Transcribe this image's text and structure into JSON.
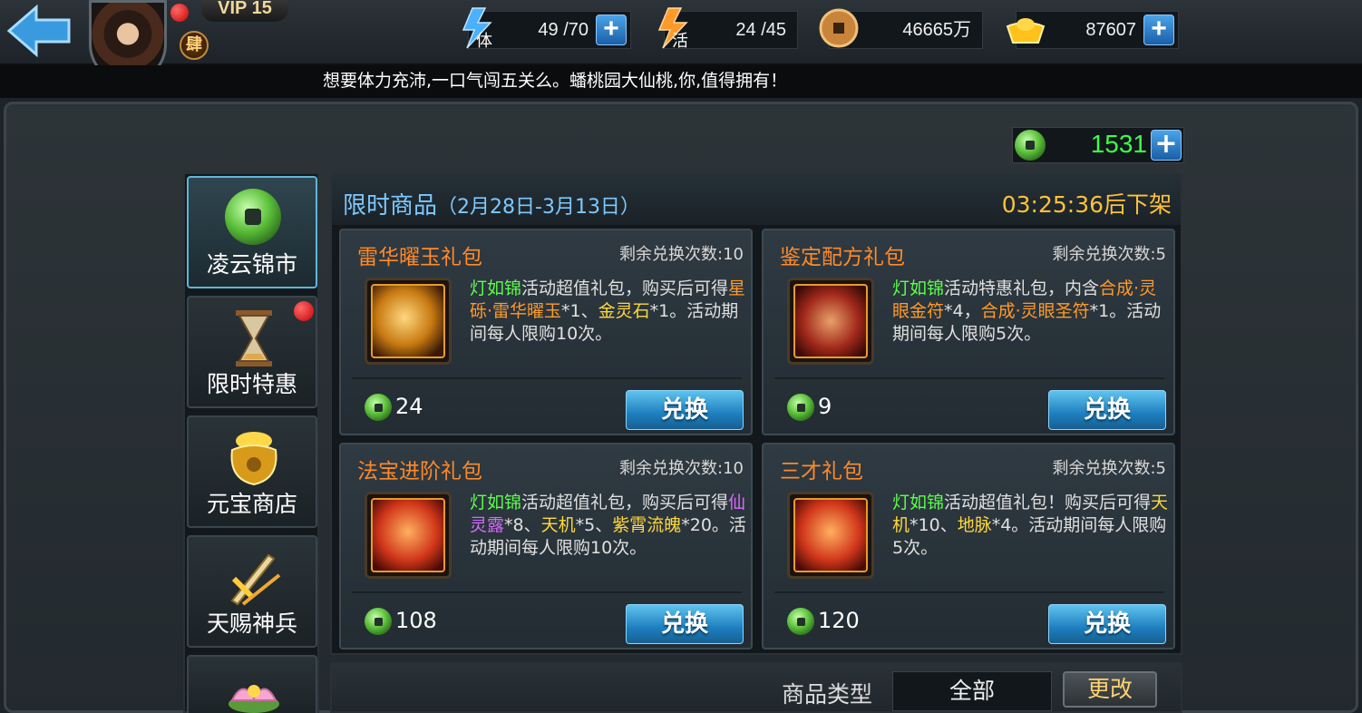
{
  "player": {
    "vip": "VIP 15",
    "rank": "肆"
  },
  "resources": {
    "stamina": {
      "icon_char": "体",
      "value": "49 /70"
    },
    "vitality": {
      "icon_char": "活",
      "value": "24 /45"
    },
    "copper": {
      "value": "46665万"
    },
    "gold": {
      "value": "87607"
    }
  },
  "marquee": "想要体力充沛,一口气闯五关么。蟠桃园大仙桃,你,值得拥有！",
  "jade_balance": "1531",
  "sidebar": {
    "items": [
      {
        "label": "凌云锦市",
        "active": true,
        "badge": false
      },
      {
        "label": "限时特惠",
        "active": false,
        "badge": true
      },
      {
        "label": "元宝商店",
        "active": false,
        "badge": false
      },
      {
        "label": "天赐神兵",
        "active": false,
        "badge": false
      }
    ]
  },
  "header": {
    "title": "限时商品",
    "date": "（2月28日-3月13日）",
    "countdown": "03:25:36后下架"
  },
  "cards": [
    {
      "name": "雷华曜玉礼包",
      "remain": "剩余兑换次数:10",
      "desc": [
        {
          "t": "灯如锦",
          "c": "g"
        },
        {
          "t": "活动超值礼包，购买后可得",
          "c": ""
        },
        {
          "t": "星砾·雷华曜玉",
          "c": "o"
        },
        {
          "t": "*1、",
          "c": ""
        },
        {
          "t": "金灵石",
          "c": "y"
        },
        {
          "t": "*1。活动期间每人限购10次。",
          "c": ""
        }
      ],
      "price": "24",
      "button": "兑换",
      "thumb_color": "#c87a12"
    },
    {
      "name": "鉴定配方礼包",
      "remain": "剩余兑换次数:5",
      "desc": [
        {
          "t": "灯如锦",
          "c": "g"
        },
        {
          "t": "活动特惠礼包，内含",
          "c": ""
        },
        {
          "t": "合成·灵眼金符",
          "c": "o"
        },
        {
          "t": "*4，",
          "c": ""
        },
        {
          "t": "合成·灵眼圣符",
          "c": "o"
        },
        {
          "t": "*1。活动期间每人限购5次。",
          "c": ""
        }
      ],
      "price": "9",
      "button": "兑换",
      "thumb_color": "#a0281a"
    },
    {
      "name": "法宝进阶礼包",
      "remain": "剩余兑换次数:10",
      "desc": [
        {
          "t": "灯如锦",
          "c": "g"
        },
        {
          "t": "活动超值礼包，购买后可得",
          "c": ""
        },
        {
          "t": "仙灵露",
          "c": "p"
        },
        {
          "t": "*8、",
          "c": ""
        },
        {
          "t": "天机",
          "c": "y"
        },
        {
          "t": "*5、",
          "c": ""
        },
        {
          "t": "紫霄流魄",
          "c": "y"
        },
        {
          "t": "*20。活动期间每人限购10次。",
          "c": ""
        }
      ],
      "price": "108",
      "button": "兑换",
      "thumb_color": "#d0361a"
    },
    {
      "name": "三才礼包",
      "remain": "剩余兑换次数:5",
      "desc": [
        {
          "t": "灯如锦",
          "c": "g"
        },
        {
          "t": "活动超值礼包！购买后可得",
          "c": ""
        },
        {
          "t": "天机",
          "c": "y"
        },
        {
          "t": "*10、",
          "c": ""
        },
        {
          "t": "地脉",
          "c": "y"
        },
        {
          "t": "*4。活动期间每人限购5次。",
          "c": ""
        }
      ],
      "price": "120",
      "button": "兑换",
      "thumb_color": "#d0361a"
    }
  ],
  "filter": {
    "label": "商品类型",
    "value": "全部",
    "button": "更改"
  },
  "colors": {
    "accent_blue": "#7ec8ff",
    "countdown": "#ffc23a",
    "item_name": "#ff8a2a",
    "jade": "#3dff4a"
  },
  "icons": [
    "back-arrow-icon",
    "stamina-icon",
    "vitality-icon",
    "copper-coin-icon",
    "gold-ingot-icon",
    "plus-icon",
    "jade-coin-icon",
    "hourglass-icon",
    "treasure-pot-icon",
    "sword-icon",
    "lotus-icon"
  ]
}
